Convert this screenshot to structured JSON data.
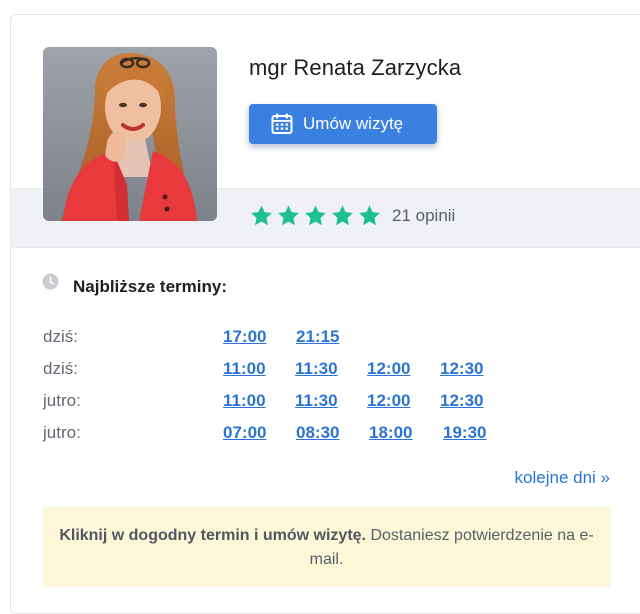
{
  "doctor": {
    "name": "mgr Renata Zarzycka",
    "book_label": "Umów wizytę",
    "photo_alt": "",
    "reviews": "21 opinii",
    "rating_stars": 5
  },
  "slots": {
    "title": "Najbliższe terminy:",
    "rows": [
      {
        "day": "dziś:",
        "times": [
          "17:00",
          "21:15"
        ]
      },
      {
        "day": "dziś:",
        "times": [
          "11:00",
          "11:30",
          "12:00",
          "12:30"
        ]
      },
      {
        "day": "jutro:",
        "times": [
          "11:00",
          "11:30",
          "12:00",
          "12:30"
        ]
      },
      {
        "day": "jutro:",
        "times": [
          "07:00",
          "08:30",
          "18:00",
          "19:30"
        ]
      }
    ],
    "more_label": "kolejne dni »"
  },
  "info": {
    "bold": "Kliknij w dogodny termin i umów wizytę.",
    "rest": " Dostaniesz potwierdzenie na e-mail."
  },
  "colors": {
    "button": "#3a80e0",
    "link": "#2b74d6",
    "star": "#1fbf94",
    "info_bg": "#fdf7d8"
  }
}
